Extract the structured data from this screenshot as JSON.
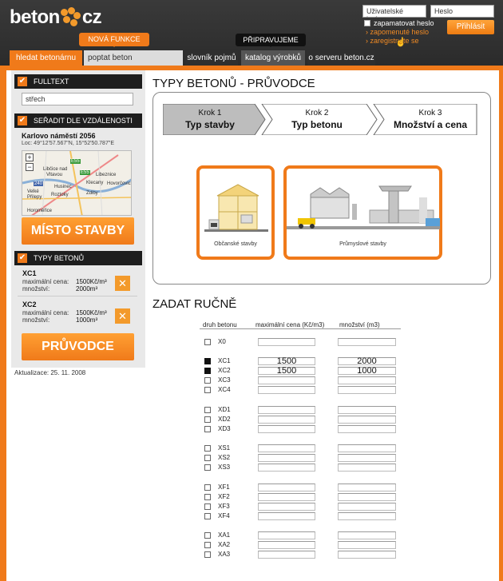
{
  "header": {
    "logo_left": "beton",
    "logo_right": "cz",
    "username_placeholder": "Uživatelské jméno",
    "password_placeholder": "Heslo",
    "remember_label": "zapamatovat heslo",
    "forgot_link": "zapomenuté heslo",
    "register_link": "zaregistrujte se",
    "login_button": "Přihlásit",
    "badge_new": "NOVÁ FUNKCE",
    "badge_soon": "PŘIPRAVUJEME"
  },
  "nav": [
    "hledat betonárnu",
    "poptat beton",
    "slovník pojmů",
    "katalog výrobků",
    "o serveru beton.cz"
  ],
  "sidebar": {
    "fulltext": {
      "title": "FULLTEXT",
      "value": "střech"
    },
    "distance": {
      "title": "SEŘADIT DLE VZDÁLENOSTI",
      "address": "Karlovo náměstí 2056",
      "loc": "Loc: 49°12'57.567\"N, 15°52'50.787\"E",
      "map_labels": [
        "Libčice nad",
        "Vltavou",
        "Roztoky",
        "Husinec",
        "Klecany",
        "Libeznice",
        "Hovorčovic",
        "Zdiby",
        "Velké",
        "Přilepy",
        "Horoměřice",
        "E55",
        "E55",
        "240"
      ],
      "button": "MÍSTO STAVBY"
    },
    "types": {
      "title": "TYPY BETONŮ",
      "items": [
        {
          "code": "XC1",
          "price_label": "maximální cena:",
          "price": "1500Kč/m³",
          "qty_label": "množství:",
          "qty": "2000m³"
        },
        {
          "code": "XC2",
          "price_label": "maximální cena:",
          "price": "1500Kč/m³",
          "qty_label": "množství:",
          "qty": "1000m³"
        }
      ],
      "remove": "✕",
      "button": "PRŮVODCE"
    },
    "updated": "Aktualizace: 25. 11. 2008"
  },
  "main": {
    "title": "TYPY BETONŮ - PRŮVODCE",
    "steps": [
      {
        "num": "Krok 1",
        "name": "Typ stavby"
      },
      {
        "num": "Krok 2",
        "name": "Typ betonu"
      },
      {
        "num": "Krok 3",
        "name": "Množství a cena"
      }
    ],
    "cards": [
      "Občanské stavby",
      "Průmyslové stavby"
    ],
    "manual_title": "ZADAT RUČNĚ",
    "table_headers": [
      "druh betonu",
      "maximální cena (Kč/m3)",
      "množství (m3)"
    ],
    "rows": [
      {
        "code": "X0",
        "checked": false,
        "price": "",
        "qty": ""
      },
      {
        "code": "XC1",
        "checked": true,
        "price": "1500",
        "qty": "2000"
      },
      {
        "code": "XC2",
        "checked": true,
        "price": "1500",
        "qty": "1000"
      },
      {
        "code": "XC3",
        "checked": false,
        "price": "",
        "qty": ""
      },
      {
        "code": "XC4",
        "checked": false,
        "price": "",
        "qty": ""
      },
      {
        "code": "XD1",
        "checked": false,
        "price": "",
        "qty": ""
      },
      {
        "code": "XD2",
        "checked": false,
        "price": "",
        "qty": ""
      },
      {
        "code": "XD3",
        "checked": false,
        "price": "",
        "qty": ""
      },
      {
        "code": "XS1",
        "checked": false,
        "price": "",
        "qty": ""
      },
      {
        "code": "XS2",
        "checked": false,
        "price": "",
        "qty": ""
      },
      {
        "code": "XS3",
        "checked": false,
        "price": "",
        "qty": ""
      },
      {
        "code": "XF1",
        "checked": false,
        "price": "",
        "qty": ""
      },
      {
        "code": "XF2",
        "checked": false,
        "price": "",
        "qty": ""
      },
      {
        "code": "XF3",
        "checked": false,
        "price": "",
        "qty": ""
      },
      {
        "code": "XF4",
        "checked": false,
        "price": "",
        "qty": ""
      },
      {
        "code": "XA1",
        "checked": false,
        "price": "",
        "qty": ""
      },
      {
        "code": "XA2",
        "checked": false,
        "price": "",
        "qty": ""
      },
      {
        "code": "XA3",
        "checked": false,
        "price": "",
        "qty": ""
      }
    ]
  },
  "colors": {
    "accent": "#f07a1a",
    "header": "#2b2b2b",
    "panel": "#e9e9e9"
  }
}
